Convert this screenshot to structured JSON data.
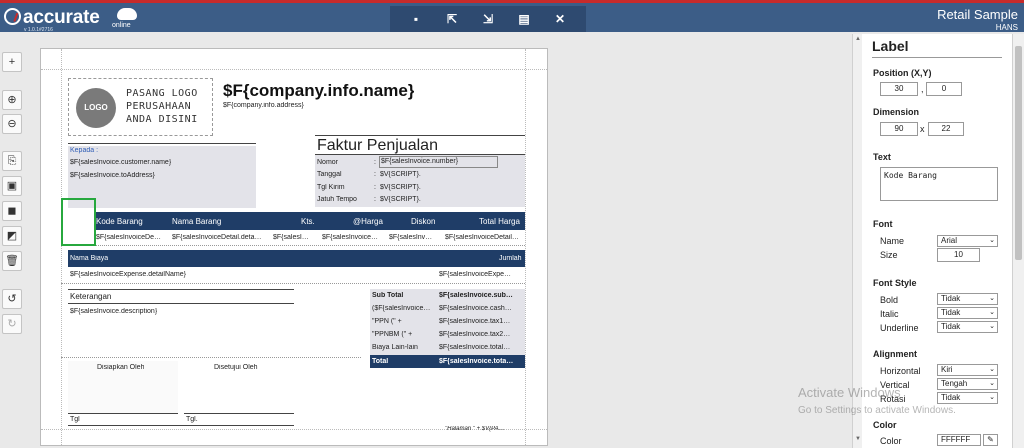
{
  "app": {
    "brand": "accurate",
    "brand_sub": "online",
    "version": "v 1.0.1#2716",
    "title": "Retail Sample",
    "user": "HANS"
  },
  "toolbar": {
    "buttons": [
      {
        "icon": "save-icon",
        "glyph": "▪"
      },
      {
        "icon": "export-icon",
        "glyph": "⇱"
      },
      {
        "icon": "import-icon",
        "glyph": "⇲"
      },
      {
        "icon": "preview-icon",
        "glyph": "▤"
      },
      {
        "icon": "close-icon",
        "glyph": "✕"
      }
    ]
  },
  "left_tools": [
    {
      "name": "add-icon",
      "glyph": "+"
    },
    {
      "name": "zoom-in-icon",
      "glyph": "⊕"
    },
    {
      "name": "zoom-out-icon",
      "glyph": "⊖"
    },
    {
      "name": "copy-icon",
      "glyph": "⎘"
    },
    {
      "name": "paste-icon",
      "glyph": "▣"
    },
    {
      "name": "bring-front-icon",
      "glyph": "◼"
    },
    {
      "name": "send-back-icon",
      "glyph": "◩"
    },
    {
      "name": "delete-icon",
      "glyph": "🗑"
    },
    {
      "name": "undo-icon",
      "glyph": "↺"
    },
    {
      "name": "redo-icon",
      "glyph": "↻"
    }
  ],
  "report": {
    "logo_circle": "LOGO",
    "logo_lines": [
      "PASANG LOGO",
      "PERUSAHAAN",
      "ANDA DISINI"
    ],
    "company_name": "$F{company.info.name}",
    "company_address": "$F{company.info.address}",
    "kepada_label": "Kepada :",
    "customer_name": "$F{salesInvoice.customer.name}",
    "to_address": "$F{salesInvoice.toAddress}",
    "doc_title": "Faktur Penjualan",
    "meta_rows": [
      {
        "label": "Nomor",
        "value": "$F{salesInvoice.number}"
      },
      {
        "label": "Tanggal",
        "value": "$V{SCRIPT}."
      },
      {
        "label": "Tgl Kirim",
        "value": "$V{SCRIPT}."
      },
      {
        "label": "Jatuh Tempo",
        "value": "$V{SCRIPT}."
      }
    ],
    "meta_colon": ":",
    "detail_headers": [
      "Kode Barang",
      "Nama Barang",
      "Kts.",
      "@Harga",
      "Diskon",
      "Total Harga"
    ],
    "detail_row": [
      "$F{salesInvoiceDe…",
      "$F{salesInvoiceDetail.deta…",
      "$F{salesI…",
      "$F{salesInvoice…",
      "$F{salesInv…",
      "$F{salesInvoiceDetail…"
    ],
    "expense_header_left": "Nama Biaya",
    "expense_header_right": "Jumlah",
    "expense_left": "$F{salesInvoiceExpense.detailName}",
    "expense_right": "$F{salesInvoiceExpe…",
    "keterangan_label": "Keterangan",
    "description": "$F{salesInvoice.description}",
    "summary_rows": [
      {
        "label": "Sub Total",
        "value": "$F{salesInvoice.sub…"
      },
      {
        "label": "($F{salesInvoice…",
        "value": "$F{salesInvoice.cash…"
      },
      {
        "label": "\"PPN (\" +",
        "value": "$F{salesInvoice.tax1…"
      },
      {
        "label": "\"PPNBM (\" +",
        "value": "$F{salesInvoice.tax2…"
      },
      {
        "label": "Biaya Lain-lain",
        "value": "$F{salesInvoice.total…"
      }
    ],
    "total_label": "Total",
    "total_value": "$F{salesInvoice.tota…",
    "prepared_by": "Disiapkan Oleh",
    "approved_by": "Disetujui Oleh",
    "tgl_left": "Tgl",
    "tgl_right": "Tgl.",
    "page_footer": "\"Halaman \" + $V{PA…"
  },
  "panel": {
    "title": "Label",
    "position_label": "Position (X,Y)",
    "x": "30",
    "comma": ",",
    "y": "0",
    "dimension_label": "Dimension",
    "w": "90",
    "times": "x",
    "h": "22",
    "text_label": "Text",
    "text_value": "Kode Barang",
    "font_label": "Font",
    "name_label": "Name",
    "name_value": "Arial",
    "size_label": "Size",
    "size_value": "10",
    "style_label": "Font Style",
    "bold_label": "Bold",
    "bold_value": "Tidak",
    "italic_label": "Italic",
    "italic_value": "Tidak",
    "underline_label": "Underline",
    "underline_value": "Tidak",
    "align_label": "Alignment",
    "horizontal_label": "Horizontal",
    "horizontal_value": "Kiri",
    "vertical_label": "Vertical",
    "vertical_value": "Tengah",
    "rotation_label": "Rotasi",
    "rotation_value": "Tidak",
    "color_section": "Color",
    "color_label": "Color",
    "color_value": "FFFFFF"
  },
  "watermark": {
    "line1": "Activate Windows",
    "line2": "Go to Settings to activate Windows."
  },
  "colors": {
    "topbar": "#3c5d87",
    "accent_red": "#c72b2b",
    "navy": "#1f3d67",
    "selection": "#27a83e"
  }
}
